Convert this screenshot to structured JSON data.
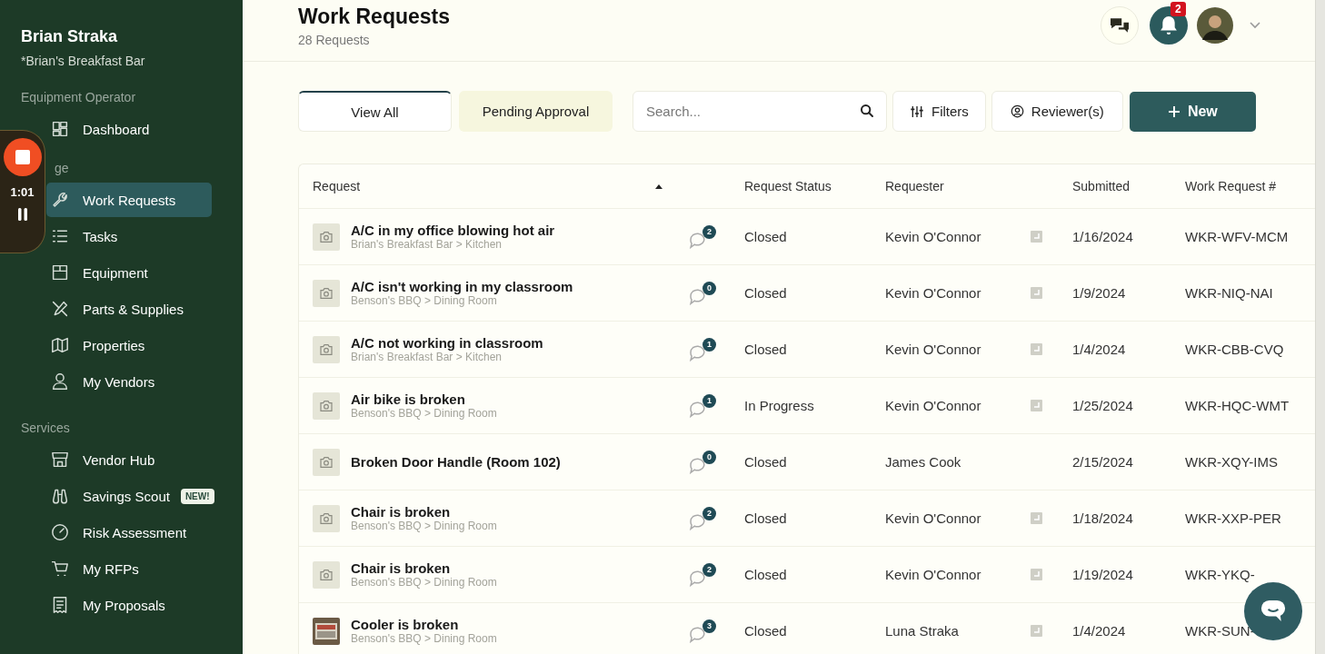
{
  "sidebar": {
    "user_name": "Brian Straka",
    "business": "*Brian's Breakfast Bar",
    "sections": [
      {
        "label": "Equipment Operator",
        "items": [
          {
            "label": "Dashboard",
            "selected": false
          }
        ]
      },
      {
        "label": "ge",
        "items": [
          {
            "label": "Work Requests",
            "selected": true
          },
          {
            "label": "Tasks",
            "selected": false
          },
          {
            "label": "Equipment",
            "selected": false
          },
          {
            "label": "Parts & Supplies",
            "selected": false
          },
          {
            "label": "Properties",
            "selected": false
          },
          {
            "label": "My Vendors",
            "selected": false
          }
        ]
      },
      {
        "label": "Services",
        "items": [
          {
            "label": "Vendor Hub",
            "selected": false
          },
          {
            "label": "Savings Scout",
            "selected": false,
            "badge": "NEW!"
          },
          {
            "label": "Risk Assessment",
            "selected": false
          },
          {
            "label": "My RFPs",
            "selected": false
          },
          {
            "label": "My Proposals",
            "selected": false
          }
        ]
      }
    ]
  },
  "recorder": {
    "time": "1:01"
  },
  "header": {
    "title": "Work Requests",
    "count": "28 Requests",
    "notifications": "2"
  },
  "tabs": [
    {
      "label": "View All",
      "selected": true
    },
    {
      "label": "Pending Approval",
      "selected": false
    }
  ],
  "search": {
    "placeholder": "Search..."
  },
  "buttons": {
    "filters": "Filters",
    "reviewers": "Reviewer(s)",
    "new": "New"
  },
  "table": {
    "columns": [
      "Request",
      "Request Status",
      "Requester",
      "Submitted",
      "Work Request #"
    ],
    "rows": [
      {
        "kind": "placeholder",
        "title": "A/C in my office blowing hot air",
        "location": "Brian's Breakfast Bar > Kitchen",
        "comments": "2",
        "status": "Closed",
        "requester": "Kevin O'Connor",
        "has_note": true,
        "submitted": "1/16/2024",
        "number": "WKR-WFV-MCM"
      },
      {
        "kind": "placeholder",
        "title": "A/C isn't working in my classroom",
        "location": "Benson's BBQ > Dining Room",
        "comments": "0",
        "status": "Closed",
        "requester": "Kevin O'Connor",
        "has_note": true,
        "submitted": "1/9/2024",
        "number": "WKR-NIQ-NAI"
      },
      {
        "kind": "placeholder",
        "title": "A/C not working in classroom",
        "location": "Brian's Breakfast Bar > Kitchen",
        "comments": "1",
        "status": "Closed",
        "requester": "Kevin O'Connor",
        "has_note": true,
        "submitted": "1/4/2024",
        "number": "WKR-CBB-CVQ"
      },
      {
        "kind": "placeholder",
        "title": "Air bike is broken",
        "location": "Benson's BBQ > Dining Room",
        "comments": "1",
        "status": "In Progress",
        "requester": "Kevin O'Connor",
        "has_note": true,
        "submitted": "1/25/2024",
        "number": "WKR-HQC-WMT"
      },
      {
        "kind": "placeholder",
        "title": "Broken Door Handle (Room 102)",
        "comments": "0",
        "status": "Closed",
        "requester": "James Cook",
        "has_note": false,
        "submitted": "2/15/2024",
        "number": "WKR-XQY-IMS"
      },
      {
        "kind": "placeholder",
        "title": "Chair is broken",
        "location": "Benson's BBQ > Dining Room",
        "comments": "2",
        "status": "Closed",
        "requester": "Kevin O'Connor",
        "has_note": true,
        "submitted": "1/18/2024",
        "number": "WKR-XXP-PER"
      },
      {
        "kind": "placeholder",
        "title": "Chair is broken",
        "location": "Benson's BBQ > Dining Room",
        "comments": "2",
        "status": "Closed",
        "requester": "Kevin O'Connor",
        "has_note": true,
        "submitted": "1/19/2024",
        "number": "WKR-YKQ-"
      },
      {
        "title": "Cooler is broken",
        "location": "Benson's BBQ > Dining Room",
        "comments": "3",
        "status": "Closed",
        "requester": "Luna Straka",
        "has_note": true,
        "submitted": "1/4/2024",
        "number": "WKR-SUN-"
      }
    ]
  }
}
